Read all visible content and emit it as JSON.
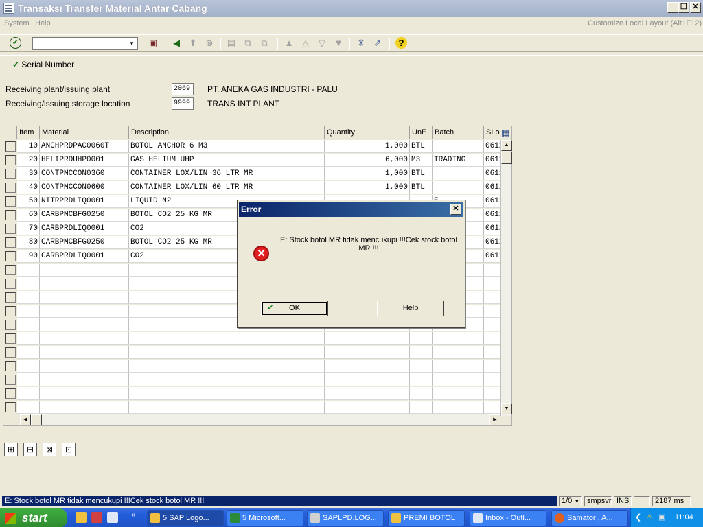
{
  "window": {
    "title": "Transaksi Transfer Material Antar Cabang"
  },
  "menu": {
    "items": [
      "System",
      "Help"
    ],
    "customize": "Customize Local Layout (Alt+F12)"
  },
  "app_toolbar": {
    "serial_number": "Serial Number"
  },
  "header_fields": {
    "receiving_plant_label": "Receiving plant/issuing plant",
    "receiving_plant_value": "2069",
    "receiving_plant_desc": "PT. ANEKA GAS INDUSTRI - PALU",
    "storage_location_label": "Receiving/issuing storage location",
    "storage_location_value": "9999",
    "storage_location_desc": "TRANS INT PLANT"
  },
  "table": {
    "columns": [
      "Item",
      "Material",
      "Description",
      "Quantity",
      "UnE",
      "Batch",
      "SLoc"
    ],
    "rows": [
      {
        "item": "10",
        "material": "ANCHPRDPAC0060T",
        "description": "BOTOL ANCHOR 6 M3",
        "quantity": "1,000",
        "une": "BTL",
        "batch": "",
        "sloc": "0612"
      },
      {
        "item": "20",
        "material": "HELIPRDUHP0001",
        "description": "GAS HELIUM UHP",
        "quantity": "6,000",
        "une": "M3",
        "batch": "TRADING",
        "sloc": "0612"
      },
      {
        "item": "30",
        "material": "CONTPMCCON0360",
        "description": "CONTAINER LOX/LIN 36 LTR MR",
        "quantity": "1,000",
        "une": "BTL",
        "batch": "",
        "sloc": "0612"
      },
      {
        "item": "40",
        "material": "CONTPMCCON0600",
        "description": "CONTAINER LOX/LIN 60 LTR MR",
        "quantity": "1,000",
        "une": "BTL",
        "batch": "",
        "sloc": "0612"
      },
      {
        "item": "50",
        "material": "NITRPRDLIQ0001",
        "description": "LIQUID N2",
        "quantity": "",
        "une": "",
        "batch": "E",
        "sloc": "0612"
      },
      {
        "item": "60",
        "material": "CARBPMCBFG0250",
        "description": "BOTOL CO2 25 KG MR",
        "quantity": "",
        "une": "",
        "batch": "",
        "sloc": "0612"
      },
      {
        "item": "70",
        "material": "CARBPRDLIQ0001",
        "description": "CO2",
        "quantity": "",
        "une": "",
        "batch": "ORY",
        "sloc": "0612"
      },
      {
        "item": "80",
        "material": "CARBPMCBFG0250",
        "description": "BOTOL CO2 25 KG MR",
        "quantity": "",
        "une": "",
        "batch": "",
        "sloc": "0612"
      },
      {
        "item": "90",
        "material": "CARBPRDLIQ0001",
        "description": "CO2",
        "quantity": "",
        "une": "",
        "batch": "ORY",
        "sloc": "0612"
      }
    ]
  },
  "dialog": {
    "title": "Error",
    "message": "E: Stock botol MR tidak mencukupi !!!Cek stock botol MR !!!",
    "ok_label": "OK",
    "help_label": "Help"
  },
  "statusbar": {
    "message": "E: Stock botol MR tidak mencukupi !!!Cek stock botol MR !!!",
    "session": "1/0",
    "server": "smpsvr",
    "mode": "INS",
    "time": "2187 ms"
  },
  "taskbar": {
    "start_label": "start",
    "tasks": [
      "5 SAP Logo...",
      "5 Microsoft...",
      "SAPLPD.LOG...",
      "PREMI BOTOL",
      "Inbox - Outl...",
      "Samator , A..."
    ],
    "clock": "11:04"
  },
  "colors": {
    "title_blue": "#0a246a",
    "status_blue": "#0a246a",
    "taskbar_blue": "#245edb",
    "start_green": "#3fae3f"
  }
}
